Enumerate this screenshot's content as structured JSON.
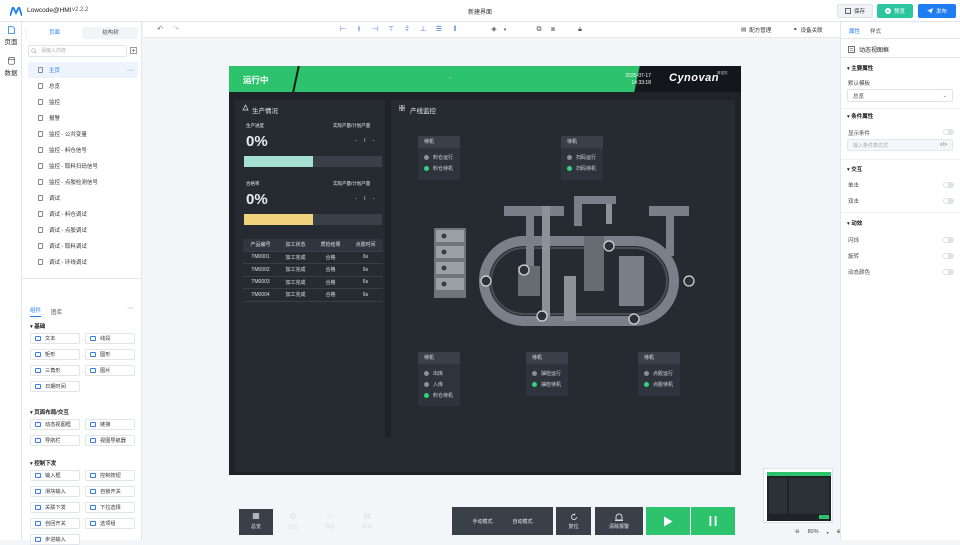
{
  "topbar": {
    "app_name": "Lowcode@HMI",
    "version": "v2.2.2",
    "page_title": "新建界面",
    "save": "保存",
    "preview": "预览",
    "publish": "发布"
  },
  "navstrip": {
    "items": [
      "页面",
      "数据"
    ]
  },
  "leftpanel": {
    "tabs": [
      "页面",
      "结构树"
    ],
    "search_placeholder": "请输入内容",
    "pages": [
      "主页",
      "总览",
      "监控",
      "报警",
      "监控 - 公共变量",
      "监控 - 料仓信号",
      "监控 - 取料扫码信号",
      "监控 - 点胶检测信号",
      "调试",
      "调试 - 料仓调试",
      "调试 - 点胶调试",
      "调试 - 取料调试",
      "调试 - 环线调试"
    ],
    "comp_tabs": [
      "组件",
      "图库"
    ],
    "groups": [
      {
        "title": "基础",
        "items": [
          "文本",
          "线段",
          "矩形",
          "圆形",
          "三角形",
          "图片",
          "日期时间"
        ]
      },
      {
        "title": "页面布局/交互",
        "items": [
          "动态视图框",
          "链接",
          "导航栏",
          "视图导航器"
        ]
      },
      {
        "title": "控制下发",
        "items": [
          "输入框",
          "控制按钮",
          "滑块输入",
          "自锁开关",
          "关联下发",
          "下拉选择",
          "自回开关",
          "选项组",
          "步进输入"
        ]
      }
    ]
  },
  "toolbar": {
    "recipe": "配方管理",
    "device": "设备关联"
  },
  "hmi": {
    "status": "运行中",
    "center_dash": "-",
    "date": "2025-07-17",
    "time": "14:33:18",
    "brand": "Cynovan",
    "brand_sub": "赛诺梵",
    "production": {
      "title": "生产情况",
      "progress_label": "生产进度",
      "progress_value": "0%",
      "progress_ratio_label": "实际产量/计划产量",
      "progress_ratio": "- / -",
      "progress_fill": 0.5,
      "yield_label": "合格率",
      "yield_value": "0%",
      "yield_ratio_label": "实际产量/计划产量",
      "yield_ratio": "- / -",
      "yield_fill": 0.5,
      "table_headers": [
        "产品编号",
        "加工状态",
        "质检结果",
        "点胶时间"
      ],
      "table_rows": [
        [
          "TM0001",
          "加工完成",
          "合格",
          "6s"
        ],
        [
          "TM0002",
          "加工完成",
          "合格",
          "6s"
        ],
        [
          "TM0003",
          "加工完成",
          "合格",
          "6s"
        ],
        [
          "TM0004",
          "加工完成",
          "合格",
          "6s"
        ]
      ]
    },
    "monitor": {
      "title": "产线监控",
      "boxes": [
        {
          "title": "待机",
          "rows": [
            [
              "料仓运行",
              "off"
            ],
            [
              "料仓待机",
              "on"
            ]
          ]
        },
        {
          "title": "待机",
          "rows": [
            [
              "扫码运行",
              "off"
            ],
            [
              "扫码待机",
              "on"
            ]
          ]
        },
        {
          "title": "待机",
          "rows": [
            [
              "出库",
              "off"
            ],
            [
              "入库",
              "off"
            ],
            [
              "料仓待机",
              "on"
            ]
          ]
        },
        {
          "title": "待机",
          "rows": [
            [
              "抽检运行",
              "off"
            ],
            [
              "抽检待机",
              "on"
            ]
          ]
        },
        {
          "title": "待机",
          "rows": [
            [
              "点胶运行",
              "off"
            ],
            [
              "点胶待机",
              "on"
            ]
          ]
        }
      ]
    },
    "nav": [
      "总览",
      "监控",
      "报警",
      "调试"
    ],
    "buttons": {
      "manual": "手动模式",
      "auto": "自动模式",
      "reset": "复位",
      "clear_alarm": "清除报警"
    }
  },
  "rightpanel": {
    "tabs": [
      "属性",
      "样式"
    ],
    "component": "动态视图框",
    "sections": {
      "main": "主要属性",
      "condition": "条件属性",
      "interaction": "交互",
      "animation": "动效"
    },
    "default_template_label": "默认模板",
    "default_template_value": "总览",
    "show_condition_label": "显示条件",
    "condition_placeholder": "输入条件表达式",
    "interaction_items": [
      "单击",
      "双击"
    ],
    "animation_items": [
      "闪烁",
      "旋转",
      "动态颜色"
    ]
  },
  "zoom": "80%"
}
